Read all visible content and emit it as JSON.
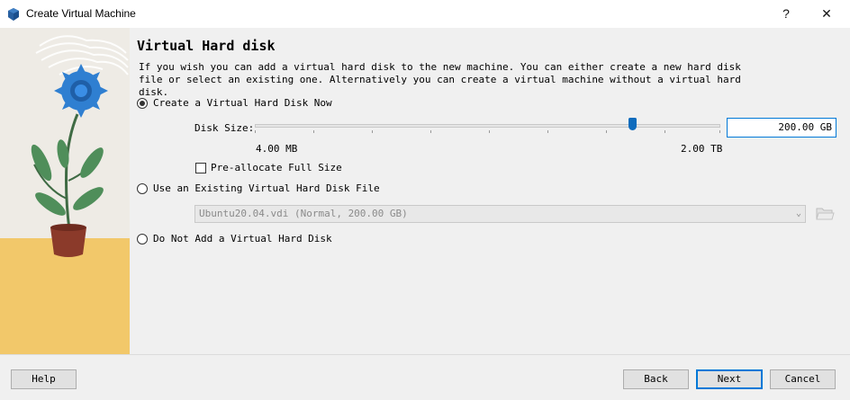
{
  "window": {
    "title": "Create Virtual Machine",
    "help_glyph": "?",
    "close_glyph": "✕"
  },
  "page": {
    "heading": "Virtual Hard disk",
    "description": "If you wish you can add a virtual hard disk to the new machine. You can either create a new hard disk file or select an existing one. Alternatively you can create a virtual machine without a virtual hard disk."
  },
  "options": {
    "create_now": {
      "label": "Create a Virtual Hard Disk Now",
      "selected": true
    },
    "disk_size": {
      "label": "Disk Size:",
      "value": "200.00 GB",
      "min_label": "4.00 MB",
      "max_label": "2.00 TB",
      "slider_fraction": 0.8
    },
    "preallocate": {
      "label": "Pre-allocate Full Size",
      "checked": false
    },
    "use_existing": {
      "label": "Use an Existing Virtual Hard Disk File",
      "selected": false
    },
    "existing_file": {
      "value": "Ubuntu20.04.vdi (Normal, 200.00 GB)"
    },
    "no_disk": {
      "label": "Do Not Add a Virtual Hard Disk",
      "selected": false
    }
  },
  "buttons": {
    "help": "Help",
    "back": "Back",
    "next": "Next",
    "cancel": "Cancel"
  },
  "colors": {
    "accent": "#0078d7",
    "slider": "#0f6cbd",
    "flower": "#2f7fd1",
    "pot": "#8b3a2a",
    "floor": "#f2c86a"
  }
}
